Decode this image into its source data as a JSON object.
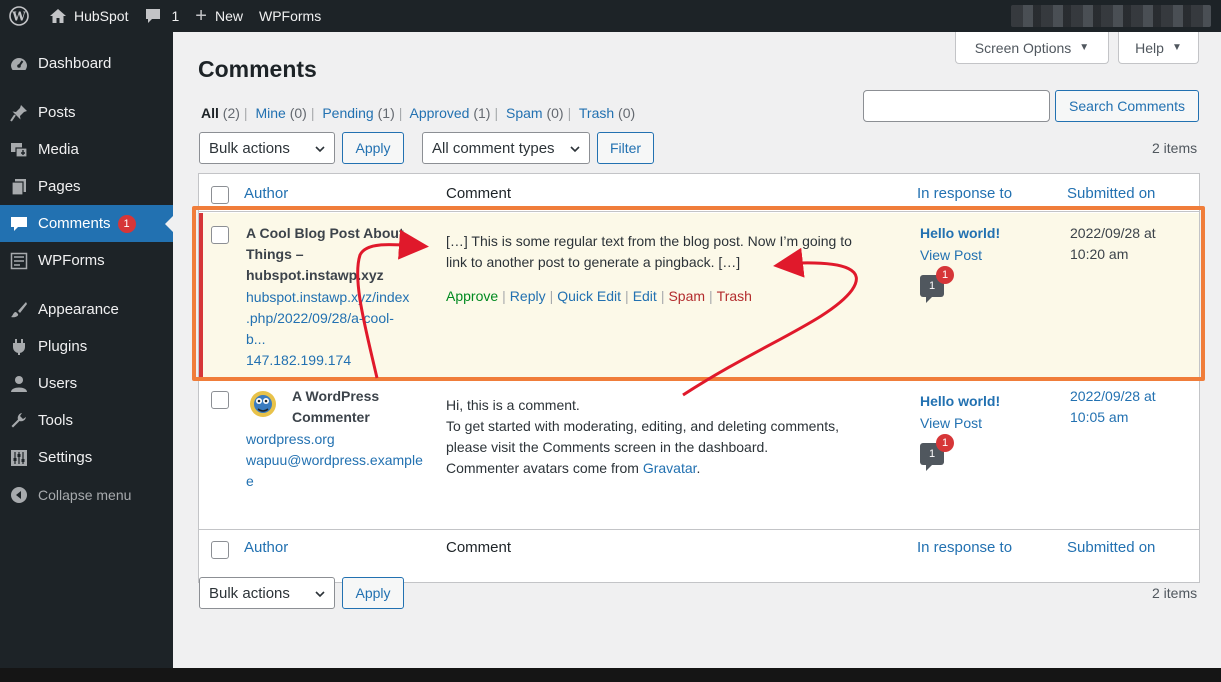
{
  "admin_bar": {
    "site_name": "HubSpot",
    "comments_count": "1",
    "new_label": "New",
    "plugin_label": "WPForms"
  },
  "sidebar": {
    "items": [
      {
        "label": "Dashboard",
        "icon": "dashboard-icon"
      },
      {
        "label": "Posts",
        "icon": "pin-icon"
      },
      {
        "label": "Media",
        "icon": "media-icon"
      },
      {
        "label": "Pages",
        "icon": "pages-icon"
      },
      {
        "label": "Comments",
        "icon": "comment-icon",
        "badge": "1",
        "active": true
      },
      {
        "label": "WPForms",
        "icon": "form-icon"
      },
      {
        "label": "Appearance",
        "icon": "brush-icon"
      },
      {
        "label": "Plugins",
        "icon": "plugin-icon"
      },
      {
        "label": "Users",
        "icon": "user-icon"
      },
      {
        "label": "Tools",
        "icon": "wrench-icon"
      },
      {
        "label": "Settings",
        "icon": "settings-icon"
      }
    ],
    "collapse_label": "Collapse menu"
  },
  "screen_meta": {
    "screen_options_label": "Screen Options",
    "help_label": "Help"
  },
  "page": {
    "title": "Comments",
    "search_button": "Search Comments",
    "search_value": "",
    "filters": [
      {
        "label": "All",
        "count": "(2)",
        "current": true
      },
      {
        "label": "Mine",
        "count": "(0)"
      },
      {
        "label": "Pending",
        "count": "(1)"
      },
      {
        "label": "Approved",
        "count": "(1)"
      },
      {
        "label": "Spam",
        "count": "(0)"
      },
      {
        "label": "Trash",
        "count": "(0)"
      }
    ],
    "separator": "|",
    "bulk_actions": "Bulk actions",
    "apply_label": "Apply",
    "comment_types": "All comment types",
    "filter_label": "Filter",
    "items_count": "2 items"
  },
  "table": {
    "columns": {
      "author": "Author",
      "comment": "Comment",
      "in_response_to": "In response to",
      "submitted_on": "Submitted on"
    },
    "rows": [
      {
        "author_name_lines": [
          "A Cool Blog Post About",
          "Things –",
          "hubspot.instawp.xyz"
        ],
        "author_url_lines": [
          "hubspot.instawp.xyz/index",
          ".php/2022/09/28/a-cool-",
          "b..."
        ],
        "author_ip": "147.182.199.174",
        "comment_lines": [
          "[…] This is some regular text from the blog post. Now I’m going to",
          "link to another post to generate a pingback. […]"
        ],
        "actions": [
          {
            "label": "Approve",
            "type": "approve"
          },
          {
            "label": "Reply",
            "type": "normal"
          },
          {
            "label": "Quick Edit",
            "type": "normal"
          },
          {
            "label": "Edit",
            "type": "normal"
          },
          {
            "label": "Spam",
            "type": "spam"
          },
          {
            "label": "Trash",
            "type": "trash"
          }
        ],
        "response_title": "Hello world!",
        "response_view": "View Post",
        "bubble_count": "1",
        "bubble_pending": "1",
        "submitted_lines": [
          "2022/09/28 at",
          "10:20 am"
        ],
        "pending": true
      },
      {
        "author_name_lines": [
          "A WordPress",
          "Commenter"
        ],
        "author_url_lines": [
          "wordpress.org"
        ],
        "author_email_lines": [
          "wapuu@wordpress.example",
          "e"
        ],
        "comment_lines": [
          "Hi, this is a comment.",
          "To get started with moderating, editing, and deleting comments,",
          "please visit the Comments screen in the dashboard."
        ],
        "comment_last_prefix": "Commenter avatars come from ",
        "comment_last_link": "Gravatar",
        "comment_last_suffix": ".",
        "response_title": "Hello world!",
        "response_view": "View Post",
        "bubble_count": "1",
        "bubble_pending": "1",
        "submitted_lines": [
          "2022/09/28 at",
          "10:05 am"
        ],
        "pending": false
      }
    ]
  },
  "colors": {
    "admin_bar": "#1d2327",
    "menu_active": "#2271b1",
    "link": "#2271b1",
    "pending_row": "#fcf9e8",
    "pending_border": "#d63638",
    "highlight_box": "#f07d3a",
    "annotation_arrow": "#e0192b"
  }
}
